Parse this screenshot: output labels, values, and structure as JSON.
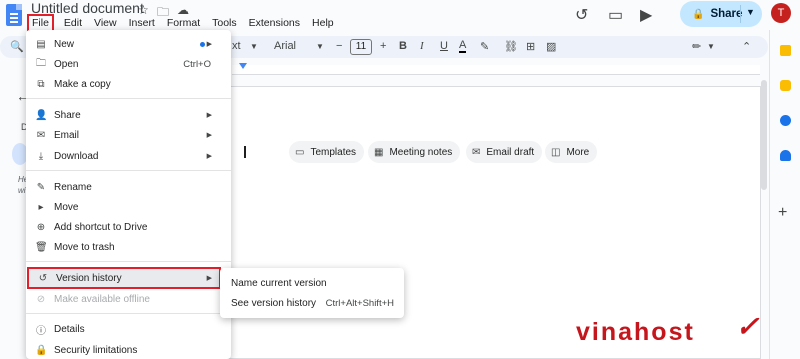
{
  "app": {
    "title": "Untitled document",
    "menu": [
      "File",
      "Edit",
      "View",
      "Insert",
      "Format",
      "Tools",
      "Extensions",
      "Help"
    ],
    "share_label": "Share",
    "avatar_letter": "T"
  },
  "toolbar": {
    "style_partial": "xt",
    "font": "Arial",
    "font_size": "11",
    "bold": "B",
    "italic": "I",
    "underline": "U",
    "text_color": "A"
  },
  "file_menu": {
    "items": [
      {
        "label": "New",
        "icon": "doc-icon",
        "submenu": true
      },
      {
        "label": "Open",
        "icon": "folder-icon",
        "shortcut": "Ctrl+O"
      },
      {
        "label": "Make a copy",
        "icon": "copy-icon"
      },
      {
        "label": "Share",
        "icon": "person-add-icon",
        "submenu": true
      },
      {
        "label": "Email",
        "icon": "mail-icon",
        "submenu": true
      },
      {
        "label": "Download",
        "icon": "download-icon",
        "submenu": true
      },
      {
        "label": "Rename",
        "icon": "pencil-icon"
      },
      {
        "label": "Move",
        "icon": "move-icon"
      },
      {
        "label": "Add shortcut to Drive",
        "icon": "drive-shortcut-icon"
      },
      {
        "label": "Move to trash",
        "icon": "trash-icon"
      },
      {
        "label": "Version history",
        "icon": "history-icon",
        "submenu": true
      },
      {
        "label": "Make available offline",
        "icon": "offline-icon",
        "disabled": true
      },
      {
        "label": "Details",
        "icon": "info-icon"
      },
      {
        "label": "Security limitations",
        "icon": "lock-icon"
      }
    ]
  },
  "version_submenu": {
    "items": [
      {
        "label": "Name current version"
      },
      {
        "label": "See version history",
        "shortcut": "Ctrl+Alt+Shift+H"
      }
    ]
  },
  "chips": [
    "Templates",
    "Meeting notes",
    "Email draft",
    "More"
  ],
  "outline": {
    "heading": "D",
    "hint_line1": "He",
    "hint_line2": "wi"
  },
  "watermark": "vinahost",
  "colors": {
    "highlight": "#e2202c",
    "share_bg": "#c2e7ff",
    "avatar": "#c5221f",
    "doc_blue": "#4285f4"
  }
}
